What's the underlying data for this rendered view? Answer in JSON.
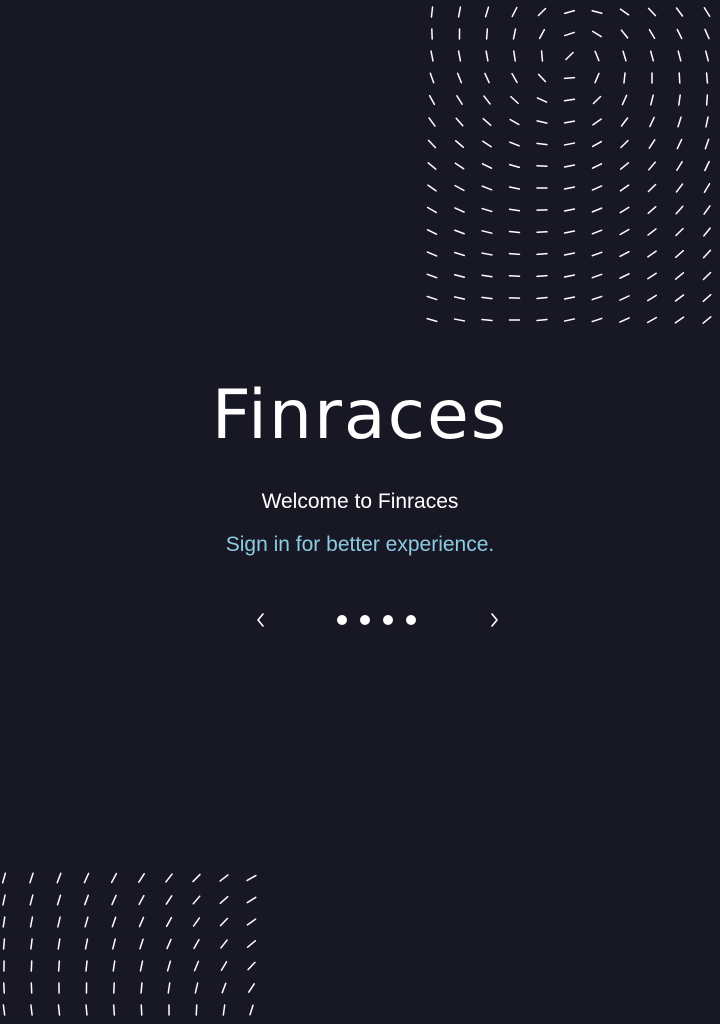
{
  "app": {
    "brand_name": "Finraces"
  },
  "hero": {
    "welcome_text": "Welcome to Finraces",
    "subtitle_text": "Sign in for better experience."
  },
  "carousel": {
    "slide_count": 4,
    "prev_icon": "chevron-left-icon",
    "next_icon": "chevron-right-icon"
  },
  "colors": {
    "background": "#181824",
    "text": "#ffffff",
    "accent": "#8ccbe3"
  }
}
